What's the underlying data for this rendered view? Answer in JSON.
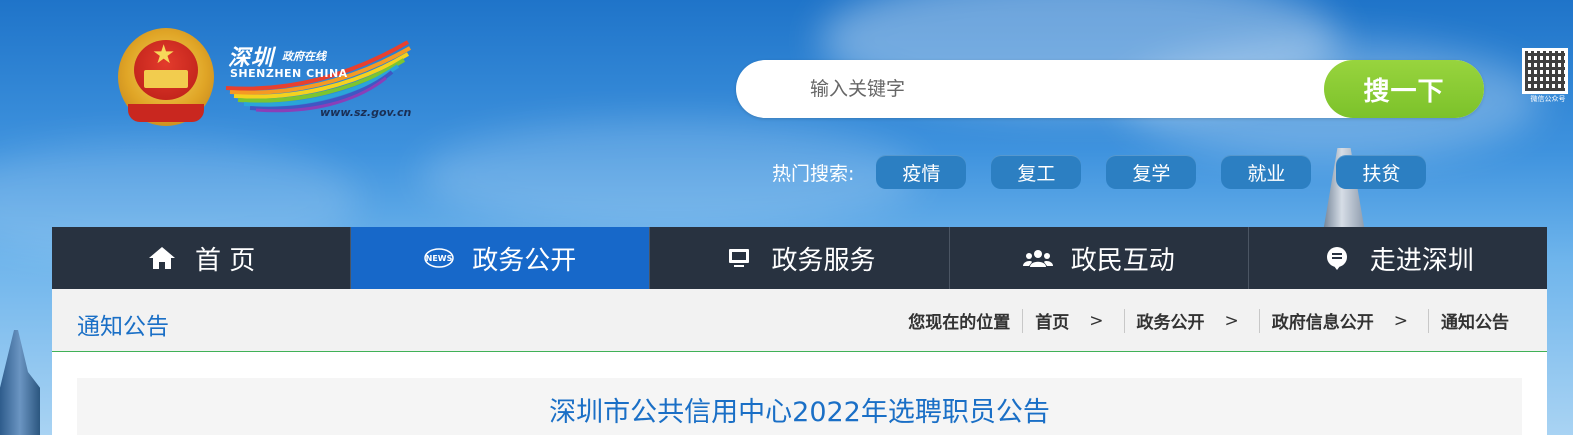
{
  "header": {
    "brand_cn": "深圳",
    "brand_cn_sub": "政府在线",
    "brand_en": "SHENZHEN  CHINA",
    "brand_url": "www.sz.gov.cn",
    "qr_caption": "微信公众号"
  },
  "search": {
    "placeholder": "输入关键字",
    "button_label": "搜一下",
    "hot_label": "热门搜索:",
    "hot_tags": [
      "疫情",
      "复工",
      "复学",
      "就业",
      "扶贫"
    ]
  },
  "nav": {
    "items": [
      {
        "label": "首 页",
        "icon": "home-icon"
      },
      {
        "label": "政务公开",
        "icon": "news-icon"
      },
      {
        "label": "政务服务",
        "icon": "monitor-icon"
      },
      {
        "label": "政民互动",
        "icon": "people-icon"
      },
      {
        "label": "走进深圳",
        "icon": "info-icon"
      }
    ],
    "active_index": 1
  },
  "section": {
    "title": "通知公告"
  },
  "breadcrumb": {
    "prefix": "您现在的位置",
    "items": [
      "首页",
      "政务公开",
      "政府信息公开",
      "通知公告"
    ],
    "separator": ">"
  },
  "article": {
    "title": "深圳市公共信用中心2022年选聘职员公告"
  },
  "colors": {
    "nav_bg": "#283240",
    "nav_active": "#1768c9",
    "search_button": "#7cc22a",
    "link_blue": "#1a6fc6",
    "divider_green": "#40b157"
  }
}
